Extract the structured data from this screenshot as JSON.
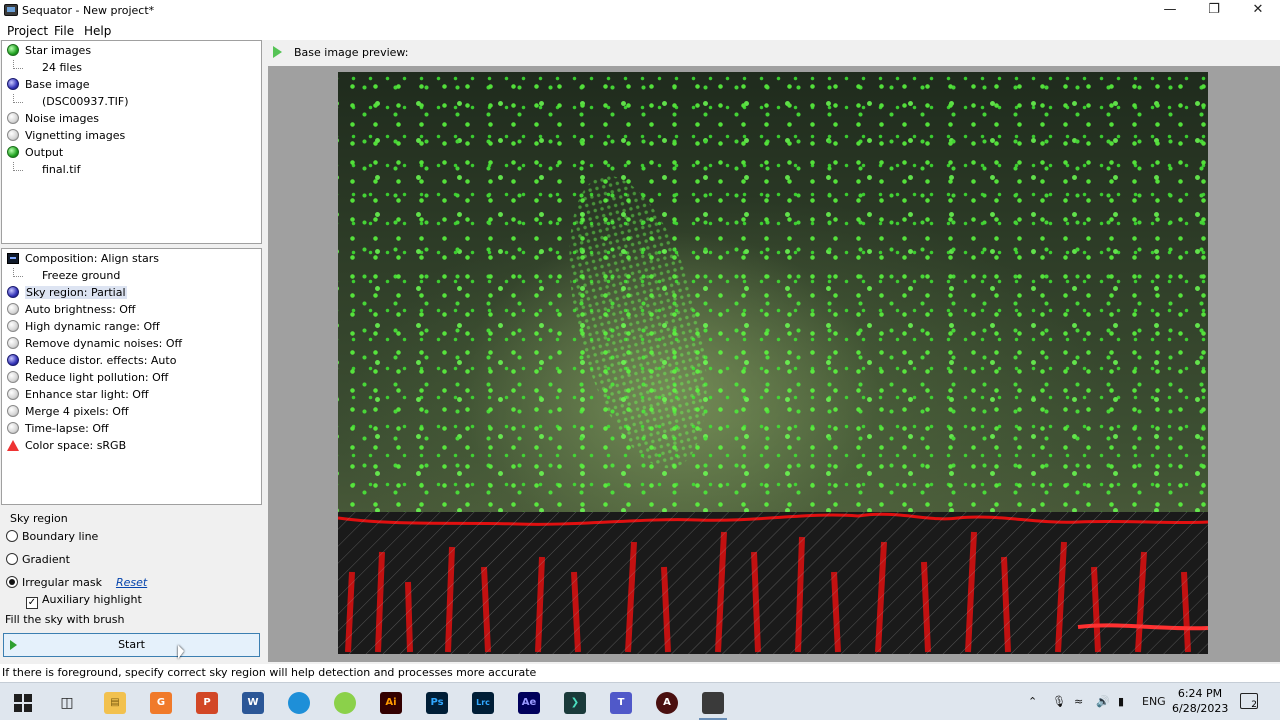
{
  "window": {
    "title": "Sequator - New project*"
  },
  "menu": [
    "Project",
    "File",
    "Help"
  ],
  "files_tree": {
    "star_images": {
      "label": "Star images",
      "child": "24 files"
    },
    "base_image": {
      "label": "Base image",
      "child": "(DSC00937.TIF)"
    },
    "noise_images": {
      "label": "Noise images"
    },
    "vignetting_images": {
      "label": "Vignetting images"
    },
    "output": {
      "label": "Output",
      "child": "final.tif"
    }
  },
  "settings": {
    "composition": "Composition: Align stars",
    "freeze_ground": "Freeze ground",
    "sky_region": "Sky region: Partial",
    "auto_brightness": "Auto brightness: Off",
    "high_dynamic_range": "High dynamic range: Off",
    "remove_dynamic_noises": "Remove dynamic noises: Off",
    "reduce_distortion": "Reduce distor. effects: Auto",
    "reduce_light_pollution": "Reduce light pollution: Off",
    "enhance_star_light": "Enhance star light: Off",
    "merge_4_pixels": "Merge 4 pixels: Off",
    "time_lapse": "Time-lapse: Off",
    "color_space": "Color space: sRGB"
  },
  "sky_region_group": {
    "title": "Sky region",
    "boundary_line": "Boundary line",
    "gradient": "Gradient",
    "irregular_mask": "Irregular mask",
    "reset": "Reset",
    "auxiliary_highlight": "Auxiliary highlight",
    "hint": "Fill the sky with brush",
    "selected": "Irregular mask",
    "auxiliary_checked": true
  },
  "start_button": "Start",
  "preview": {
    "label": "Base image preview:"
  },
  "status": "If there is foreground, specify correct sky region will help detection and processes more accurate",
  "taskbar": {
    "apps": [
      {
        "name": "task-view",
        "text": ""
      },
      {
        "name": "file-explorer",
        "text": ""
      },
      {
        "name": "app-orange",
        "text": "G"
      },
      {
        "name": "powerpoint",
        "text": "P"
      },
      {
        "name": "word",
        "text": "W"
      },
      {
        "name": "edge",
        "text": ""
      },
      {
        "name": "app-green",
        "text": ""
      },
      {
        "name": "illustrator",
        "text": "Ai"
      },
      {
        "name": "photoshop",
        "text": "Ps"
      },
      {
        "name": "lightroom",
        "text": "Lrc"
      },
      {
        "name": "after-effects",
        "text": "Ae"
      },
      {
        "name": "app-terminal",
        "text": ""
      },
      {
        "name": "teams",
        "text": ""
      },
      {
        "name": "app-a",
        "text": "A"
      },
      {
        "name": "sequator",
        "text": ""
      }
    ],
    "language": "ENG",
    "time": "6:24 PM",
    "date": "6/28/2023",
    "notifications": "2"
  },
  "colors": {
    "star_marker": "#5cff3f",
    "foreground_outline": "#e01010",
    "selection": "#dde4f2",
    "start_border": "#3c7fb1"
  }
}
